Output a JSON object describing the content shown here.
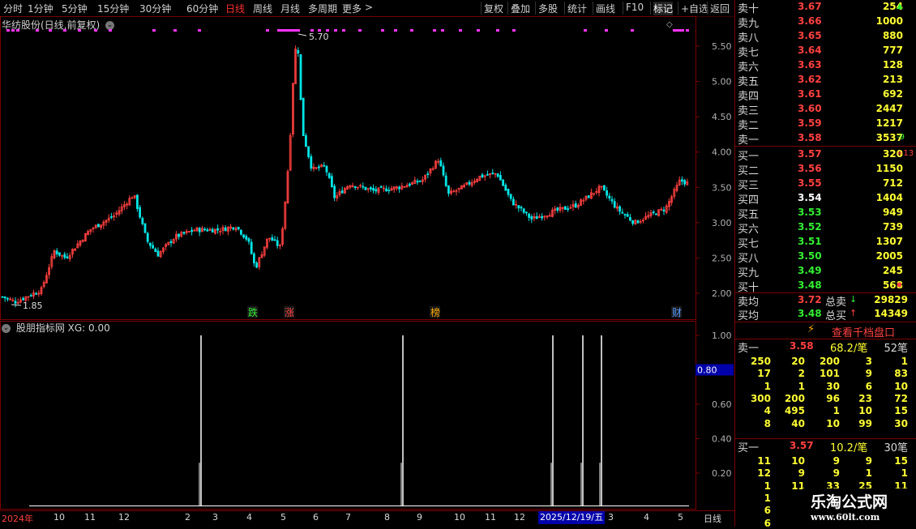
{
  "toolbar": {
    "periods": [
      "分时",
      "1分钟",
      "5分钟",
      "15分钟",
      "30分钟",
      "60分钟",
      "日线",
      "周线",
      "月线",
      "多周期",
      "更多"
    ],
    "active_period": "日线",
    "more_arrow": ">",
    "right_buttons": [
      "复权",
      "叠加",
      "多股",
      "统计",
      "画线",
      "F10",
      "标记",
      "+自选",
      "返回"
    ]
  },
  "main_chart": {
    "title": "华纺股份(日线,前复权)",
    "high_label": "5.70",
    "low_label": "1.85",
    "y_ticks": [
      "5.50",
      "5.00",
      "4.50",
      "4.00",
      "3.50",
      "3.00",
      "2.50",
      "2.00"
    ],
    "markers": [
      {
        "text": "跌",
        "color": "#33ee33"
      },
      {
        "text": "涨",
        "color": "#ff4040"
      },
      {
        "text": "榜",
        "color": "#ffaa00"
      },
      {
        "text": "财",
        "color": "#5599ff"
      }
    ]
  },
  "sub_chart": {
    "title": "股朋指标网 XG: 0.00",
    "y_ticks": [
      "1.00",
      "0.80",
      "0.60",
      "0.40",
      "0.20"
    ],
    "current_value": "0.80"
  },
  "date_axis": {
    "labels": [
      "2024年",
      "10",
      "11",
      "12",
      "2",
      "3",
      "4",
      "5",
      "6",
      "7",
      "8",
      "9",
      "10",
      "11",
      "12",
      "2",
      "3",
      "4",
      "5"
    ],
    "cursor_date": "2025/12/19/五",
    "period_label": "日线"
  },
  "order_book": {
    "sell": [
      {
        "name": "卖十",
        "price": "3.67",
        "vol": "254",
        "chg": "▲",
        "chg_color": "#33ee33"
      },
      {
        "name": "卖九",
        "price": "3.66",
        "vol": "1000",
        "chg": ""
      },
      {
        "name": "卖八",
        "price": "3.65",
        "vol": "880",
        "chg": ""
      },
      {
        "name": "卖七",
        "price": "3.64",
        "vol": "777",
        "chg": ""
      },
      {
        "name": "卖六",
        "price": "3.63",
        "vol": "128",
        "chg": ""
      },
      {
        "name": "卖五",
        "price": "3.62",
        "vol": "213",
        "chg": ""
      },
      {
        "name": "卖四",
        "price": "3.61",
        "vol": "692",
        "chg": ""
      },
      {
        "name": "卖三",
        "price": "3.60",
        "vol": "2447",
        "chg": ""
      },
      {
        "name": "卖二",
        "price": "3.59",
        "vol": "1217",
        "chg": ""
      },
      {
        "name": "卖一",
        "price": "3.58",
        "vol": "3537",
        "chg": "-9",
        "chg_color": "#33ee33"
      }
    ],
    "buy": [
      {
        "name": "买一",
        "price": "3.57",
        "vol": "320",
        "chg": "+13",
        "chg_color": "#ff4040",
        "price_color": "#ff4040"
      },
      {
        "name": "买二",
        "price": "3.56",
        "vol": "1150",
        "chg": "",
        "price_color": "#ff4040"
      },
      {
        "name": "买三",
        "price": "3.55",
        "vol": "712",
        "chg": "",
        "price_color": "#ff4040"
      },
      {
        "name": "买四",
        "price": "3.54",
        "vol": "1404",
        "chg": "",
        "price_color": "#ffffff"
      },
      {
        "name": "买五",
        "price": "3.53",
        "vol": "949",
        "chg": "",
        "price_color": "#33ee33"
      },
      {
        "name": "买六",
        "price": "3.52",
        "vol": "739",
        "chg": "",
        "price_color": "#33ee33"
      },
      {
        "name": "买七",
        "price": "3.51",
        "vol": "1307",
        "chg": "",
        "price_color": "#33ee33"
      },
      {
        "name": "买八",
        "price": "3.50",
        "vol": "2005",
        "chg": "",
        "price_color": "#33ee33"
      },
      {
        "name": "买九",
        "price": "3.49",
        "vol": "245",
        "chg": "",
        "price_color": "#33ee33"
      },
      {
        "name": "买十",
        "price": "3.48",
        "vol": "568",
        "chg": "▪",
        "chg_color": "#ff4040",
        "price_color": "#33ee33"
      }
    ],
    "sell_avg": {
      "label": "卖均",
      "price": "3.72",
      "total_label": "总卖",
      "total": "29829"
    },
    "buy_avg": {
      "label": "买均",
      "price": "3.48",
      "total_label": "总买",
      "total": "14349"
    },
    "thousand_button": "查看千档盘口",
    "sell1_detail": {
      "label": "卖一",
      "price": "3.58",
      "per": "68.2/笔",
      "count": "52笔"
    },
    "sell1_grid": [
      [
        "250",
        "20",
        "200",
        "3",
        "1"
      ],
      [
        "17",
        "2",
        "101",
        "9",
        "83"
      ],
      [
        "1",
        "1",
        "30",
        "6",
        "10"
      ],
      [
        "300",
        "200",
        "96",
        "23",
        "72"
      ],
      [
        "4",
        "495",
        "1",
        "10",
        "15"
      ],
      [
        "8",
        "40",
        "10",
        "99",
        "30"
      ]
    ],
    "buy1_detail": {
      "label": "买一",
      "price": "3.57",
      "per": "10.2/笔",
      "count": "30笔"
    },
    "buy1_grid": [
      [
        "11",
        "10",
        "9",
        "9",
        "15"
      ],
      [
        "12",
        "9",
        "9",
        "1",
        "1"
      ],
      [
        "1",
        "11",
        "33",
        "25",
        "11"
      ],
      [
        "1",
        "",
        "",
        "",
        ""
      ],
      [
        "6",
        "",
        "",
        "",
        ""
      ],
      [
        "6",
        "",
        "",
        "",
        ""
      ]
    ]
  },
  "watermark": {
    "line1": "乐淘公式网",
    "line2": "www.60lt.com"
  },
  "colors": {
    "up": "#ff4040",
    "down": "#00e5e5",
    "grid": "#7a0000",
    "signal": "#ffffff",
    "marker": "#ff33ff"
  }
}
